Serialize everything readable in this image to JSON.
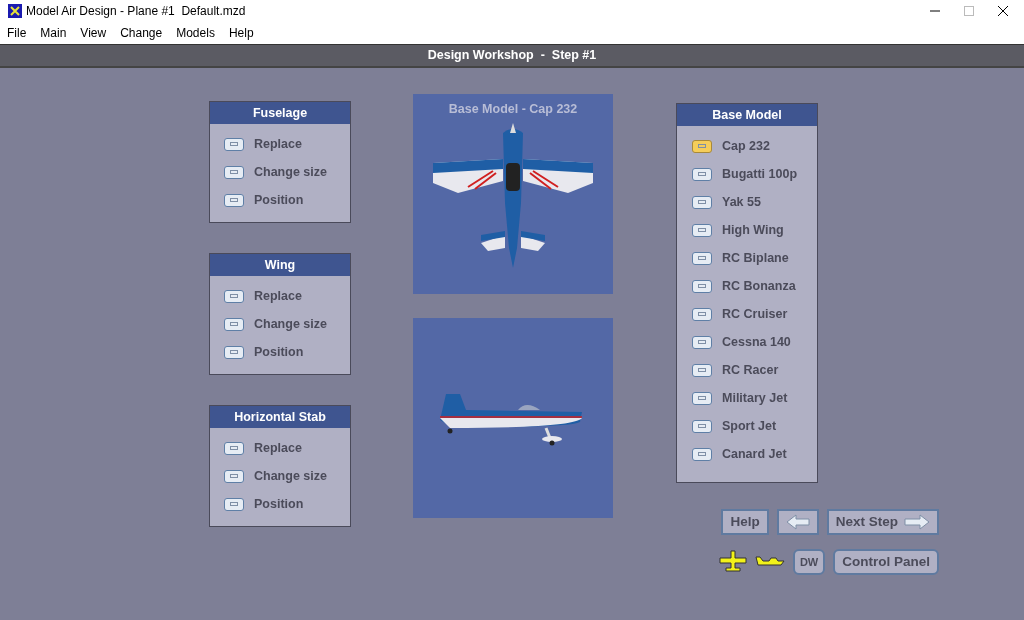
{
  "window": {
    "title": "Model Air Design - Plane #1  Default.mzd"
  },
  "menu": [
    "File",
    "Main",
    "View",
    "Change",
    "Models",
    "Help"
  ],
  "header": "Design Workshop  -  Step #1",
  "panels": [
    {
      "title": "Fuselage",
      "items": [
        "Replace",
        "Change size",
        "Position"
      ]
    },
    {
      "title": "Wing",
      "items": [
        "Replace",
        "Change size",
        "Position"
      ]
    },
    {
      "title": "Horizontal Stab",
      "items": [
        "Replace",
        "Change size",
        "Position"
      ]
    }
  ],
  "preview": {
    "title": "Base Model - Cap 232"
  },
  "base_model": {
    "title": "Base Model",
    "items": [
      {
        "label": "Cap 232",
        "selected": true
      },
      {
        "label": "Bugatti 100p",
        "selected": false
      },
      {
        "label": "Yak 55",
        "selected": false
      },
      {
        "label": "High Wing",
        "selected": false
      },
      {
        "label": "RC Biplane",
        "selected": false
      },
      {
        "label": "RC Bonanza",
        "selected": false
      },
      {
        "label": "RC Cruiser",
        "selected": false
      },
      {
        "label": "Cessna 140",
        "selected": false
      },
      {
        "label": "RC Racer",
        "selected": false
      },
      {
        "label": "Military Jet",
        "selected": false
      },
      {
        "label": "Sport Jet",
        "selected": false
      },
      {
        "label": "Canard Jet",
        "selected": false
      }
    ]
  },
  "buttons": {
    "help": "Help",
    "next": "Next Step",
    "dw": "DW",
    "control_panel": "Control Panel"
  }
}
